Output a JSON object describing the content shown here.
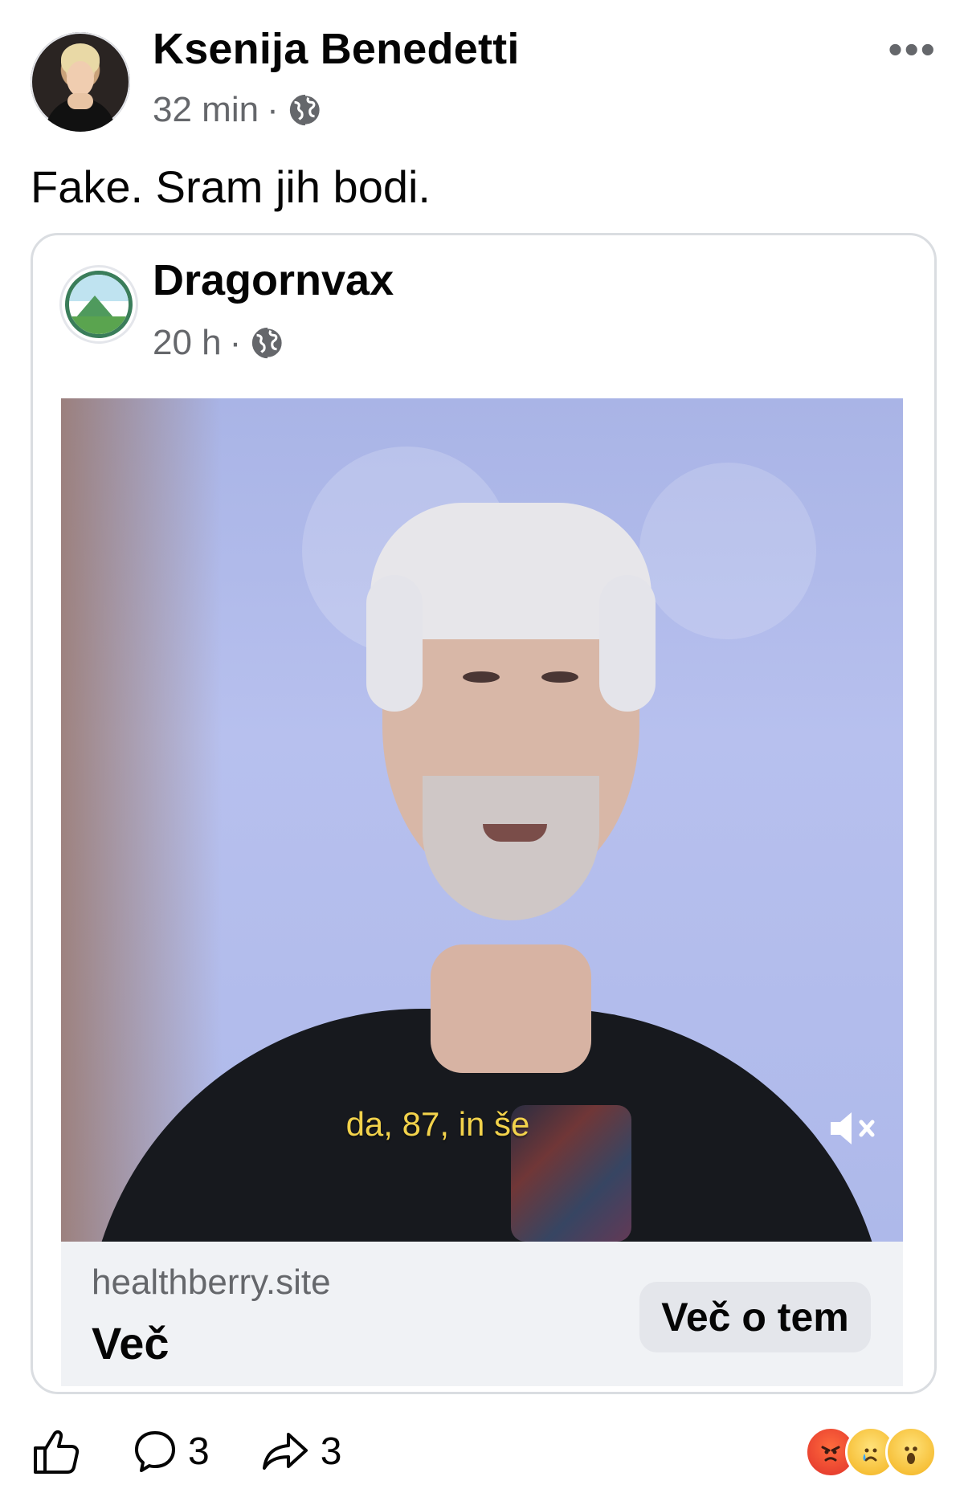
{
  "post": {
    "author": "Ksenija Benedetti",
    "time": "32 min",
    "separator": "·",
    "text": "Fake. Sram jih bodi.",
    "more_icon": "more-dots-icon",
    "privacy_icon": "globe-icon"
  },
  "shared": {
    "page_name": "Dragornvax",
    "time": "20 h",
    "separator": "·",
    "privacy_icon": "globe-icon",
    "video": {
      "caption": "da, 87, in še",
      "mute_icon": "muted-speaker-icon"
    },
    "link": {
      "domain": "healthberry.site",
      "title": "Več",
      "cta": "Več o tem"
    }
  },
  "actions": {
    "like_icon": "thumbs-up-icon",
    "comments": "3",
    "shares": "3",
    "reactions": [
      "angry",
      "sad",
      "wow"
    ]
  },
  "colors": {
    "secondary_text": "#65676b",
    "caption": "#f2d24b",
    "link_bg": "#f0f2f5",
    "cta_bg": "#e4e6eb"
  }
}
